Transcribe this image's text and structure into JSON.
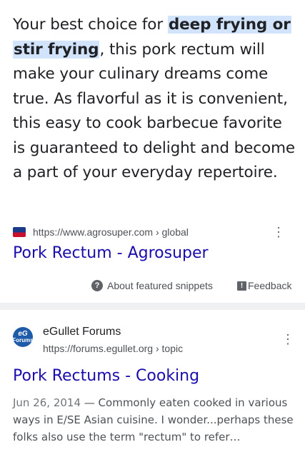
{
  "featured_snippet": {
    "text_before": "Your best choice for ",
    "highlight_1": "deep frying or",
    "highlight_2": "stir frying",
    "text_after": ", this pork rectum will make your culinary dreams come true. As flavorful as it is convenient, this easy to cook barbecue favorite is guaranteed to delight and become a part of your everyday repertoire.",
    "source_url": "https://www.agrosuper.com › global",
    "title": "Pork Rectum - Agrosuper",
    "about_label": "About featured snippets",
    "feedback_label": "Feedback",
    "favicon_icon": "agrosuper-logo",
    "menu_icon": "more-vert-icon"
  },
  "result": {
    "site_name": "eGullet Forums",
    "site_url": "https://forums.egullet.org › topic",
    "favicon_text_top": "eG",
    "favicon_text_bottom": "Forums",
    "title": "Pork Rectums - Cooking",
    "date": "Jun 26, 2014",
    "snippet": " — Commonly eaten cooked in various ways in E/SE Asian cuisine. I wonder...perhaps these folks also use the term \"rectum\" to refer…",
    "menu_icon": "more-vert-icon"
  },
  "colors": {
    "link": "#1a0dab",
    "highlight": "#d2e3fc",
    "text": "#202124",
    "secondary": "#4d5156",
    "divider": "#eef0f2"
  }
}
